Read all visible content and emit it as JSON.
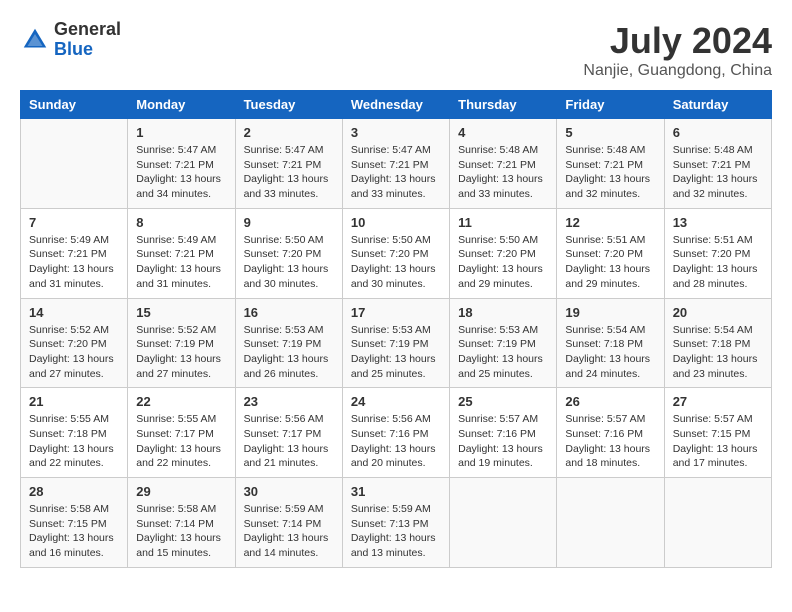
{
  "header": {
    "logo": {
      "general": "General",
      "blue": "Blue"
    },
    "title": "July 2024",
    "location": "Nanjie, Guangdong, China"
  },
  "days_of_week": [
    "Sunday",
    "Monday",
    "Tuesday",
    "Wednesday",
    "Thursday",
    "Friday",
    "Saturday"
  ],
  "weeks": [
    [
      {
        "day": "",
        "info": ""
      },
      {
        "day": "1",
        "info": "Sunrise: 5:47 AM\nSunset: 7:21 PM\nDaylight: 13 hours\nand 34 minutes."
      },
      {
        "day": "2",
        "info": "Sunrise: 5:47 AM\nSunset: 7:21 PM\nDaylight: 13 hours\nand 33 minutes."
      },
      {
        "day": "3",
        "info": "Sunrise: 5:47 AM\nSunset: 7:21 PM\nDaylight: 13 hours\nand 33 minutes."
      },
      {
        "day": "4",
        "info": "Sunrise: 5:48 AM\nSunset: 7:21 PM\nDaylight: 13 hours\nand 33 minutes."
      },
      {
        "day": "5",
        "info": "Sunrise: 5:48 AM\nSunset: 7:21 PM\nDaylight: 13 hours\nand 32 minutes."
      },
      {
        "day": "6",
        "info": "Sunrise: 5:48 AM\nSunset: 7:21 PM\nDaylight: 13 hours\nand 32 minutes."
      }
    ],
    [
      {
        "day": "7",
        "info": "Sunrise: 5:49 AM\nSunset: 7:21 PM\nDaylight: 13 hours\nand 31 minutes."
      },
      {
        "day": "8",
        "info": "Sunrise: 5:49 AM\nSunset: 7:21 PM\nDaylight: 13 hours\nand 31 minutes."
      },
      {
        "day": "9",
        "info": "Sunrise: 5:50 AM\nSunset: 7:20 PM\nDaylight: 13 hours\nand 30 minutes."
      },
      {
        "day": "10",
        "info": "Sunrise: 5:50 AM\nSunset: 7:20 PM\nDaylight: 13 hours\nand 30 minutes."
      },
      {
        "day": "11",
        "info": "Sunrise: 5:50 AM\nSunset: 7:20 PM\nDaylight: 13 hours\nand 29 minutes."
      },
      {
        "day": "12",
        "info": "Sunrise: 5:51 AM\nSunset: 7:20 PM\nDaylight: 13 hours\nand 29 minutes."
      },
      {
        "day": "13",
        "info": "Sunrise: 5:51 AM\nSunset: 7:20 PM\nDaylight: 13 hours\nand 28 minutes."
      }
    ],
    [
      {
        "day": "14",
        "info": "Sunrise: 5:52 AM\nSunset: 7:20 PM\nDaylight: 13 hours\nand 27 minutes."
      },
      {
        "day": "15",
        "info": "Sunrise: 5:52 AM\nSunset: 7:19 PM\nDaylight: 13 hours\nand 27 minutes."
      },
      {
        "day": "16",
        "info": "Sunrise: 5:53 AM\nSunset: 7:19 PM\nDaylight: 13 hours\nand 26 minutes."
      },
      {
        "day": "17",
        "info": "Sunrise: 5:53 AM\nSunset: 7:19 PM\nDaylight: 13 hours\nand 25 minutes."
      },
      {
        "day": "18",
        "info": "Sunrise: 5:53 AM\nSunset: 7:19 PM\nDaylight: 13 hours\nand 25 minutes."
      },
      {
        "day": "19",
        "info": "Sunrise: 5:54 AM\nSunset: 7:18 PM\nDaylight: 13 hours\nand 24 minutes."
      },
      {
        "day": "20",
        "info": "Sunrise: 5:54 AM\nSunset: 7:18 PM\nDaylight: 13 hours\nand 23 minutes."
      }
    ],
    [
      {
        "day": "21",
        "info": "Sunrise: 5:55 AM\nSunset: 7:18 PM\nDaylight: 13 hours\nand 22 minutes."
      },
      {
        "day": "22",
        "info": "Sunrise: 5:55 AM\nSunset: 7:17 PM\nDaylight: 13 hours\nand 22 minutes."
      },
      {
        "day": "23",
        "info": "Sunrise: 5:56 AM\nSunset: 7:17 PM\nDaylight: 13 hours\nand 21 minutes."
      },
      {
        "day": "24",
        "info": "Sunrise: 5:56 AM\nSunset: 7:16 PM\nDaylight: 13 hours\nand 20 minutes."
      },
      {
        "day": "25",
        "info": "Sunrise: 5:57 AM\nSunset: 7:16 PM\nDaylight: 13 hours\nand 19 minutes."
      },
      {
        "day": "26",
        "info": "Sunrise: 5:57 AM\nSunset: 7:16 PM\nDaylight: 13 hours\nand 18 minutes."
      },
      {
        "day": "27",
        "info": "Sunrise: 5:57 AM\nSunset: 7:15 PM\nDaylight: 13 hours\nand 17 minutes."
      }
    ],
    [
      {
        "day": "28",
        "info": "Sunrise: 5:58 AM\nSunset: 7:15 PM\nDaylight: 13 hours\nand 16 minutes."
      },
      {
        "day": "29",
        "info": "Sunrise: 5:58 AM\nSunset: 7:14 PM\nDaylight: 13 hours\nand 15 minutes."
      },
      {
        "day": "30",
        "info": "Sunrise: 5:59 AM\nSunset: 7:14 PM\nDaylight: 13 hours\nand 14 minutes."
      },
      {
        "day": "31",
        "info": "Sunrise: 5:59 AM\nSunset: 7:13 PM\nDaylight: 13 hours\nand 13 minutes."
      },
      {
        "day": "",
        "info": ""
      },
      {
        "day": "",
        "info": ""
      },
      {
        "day": "",
        "info": ""
      }
    ]
  ]
}
